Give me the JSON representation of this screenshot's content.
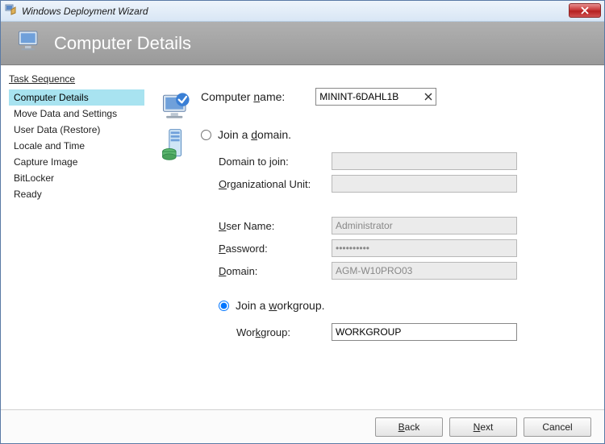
{
  "window": {
    "title": "Windows Deployment Wizard"
  },
  "header": {
    "title": "Computer Details"
  },
  "sidebar": {
    "heading": "Task Sequence",
    "items": [
      {
        "label": "Computer Details",
        "selected": true
      },
      {
        "label": "Move Data and Settings"
      },
      {
        "label": "User Data (Restore)"
      },
      {
        "label": "Locale and Time"
      },
      {
        "label": "Capture Image"
      },
      {
        "label": "BitLocker"
      },
      {
        "label": "Ready"
      }
    ]
  },
  "form": {
    "computer_name_label_pre": "Computer ",
    "computer_name_label_ul": "n",
    "computer_name_label_post": "ame:",
    "computer_name_value": "MININT-6DAHL1B",
    "radio_domain_pre": "Join a ",
    "radio_domain_ul": "d",
    "radio_domain_post": "omain.",
    "domain_join_pre": "Domain to ",
    "domain_join_ul": "j",
    "domain_join_post": "oin:",
    "domain_join_value": "",
    "ou_ul": "O",
    "ou_post": "rganizational Unit:",
    "ou_value": "",
    "username_ul": "U",
    "username_post": "ser Name:",
    "username_value": "Administrator",
    "password_ul": "P",
    "password_post": "assword:",
    "password_value": "••••••••••",
    "domain_ul": "D",
    "domain_post": "omain:",
    "domain_value": "AGM-W10PRO03",
    "radio_wg_pre": "Join a ",
    "radio_wg_ul": "w",
    "radio_wg_post": "orkgroup.",
    "workgroup_label_pre": "Wor",
    "workgroup_ul": "k",
    "workgroup_label_post": "group:",
    "workgroup_value": "WORKGROUP"
  },
  "buttons": {
    "back_ul": "B",
    "back_post": "ack",
    "next_ul": "N",
    "next_post": "ext",
    "cancel": "Cancel"
  }
}
